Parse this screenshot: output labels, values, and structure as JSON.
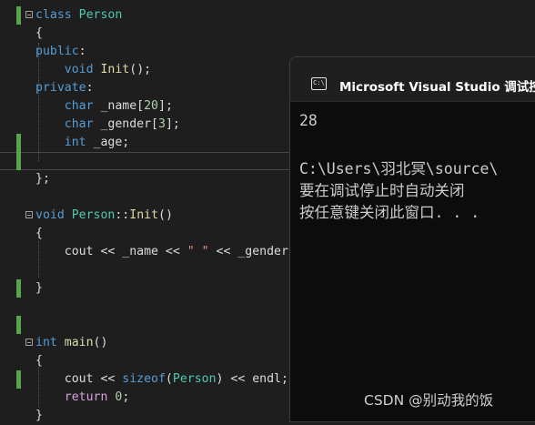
{
  "editor": {
    "lines": [
      {
        "segments": [
          {
            "text": "class",
            "c": "kw"
          },
          {
            "text": " "
          },
          {
            "text": "Person",
            "c": "ty"
          }
        ]
      },
      {
        "segments": [
          {
            "text": "{"
          }
        ]
      },
      {
        "segments": [
          {
            "text": "public",
            "c": "kw"
          },
          {
            "text": ":"
          }
        ]
      },
      {
        "segments": [
          {
            "text": "    "
          },
          {
            "text": "void",
            "c": "kw"
          },
          {
            "text": " "
          },
          {
            "text": "Init",
            "c": "fn"
          },
          {
            "text": "();"
          }
        ]
      },
      {
        "segments": [
          {
            "text": "private",
            "c": "kw"
          },
          {
            "text": ":"
          }
        ]
      },
      {
        "segments": [
          {
            "text": "    "
          },
          {
            "text": "char",
            "c": "kw"
          },
          {
            "text": " _name["
          },
          {
            "text": "20",
            "c": "num"
          },
          {
            "text": "];"
          }
        ]
      },
      {
        "segments": [
          {
            "text": "    "
          },
          {
            "text": "char",
            "c": "kw"
          },
          {
            "text": " _gender["
          },
          {
            "text": "3",
            "c": "num"
          },
          {
            "text": "];"
          }
        ]
      },
      {
        "segments": [
          {
            "text": "    "
          },
          {
            "text": "int",
            "c": "kw"
          },
          {
            "text": " _age;"
          }
        ]
      },
      {
        "segments": [
          {
            "text": ""
          }
        ]
      },
      {
        "segments": [
          {
            "text": "};"
          }
        ]
      },
      {
        "segments": [
          {
            "text": ""
          }
        ]
      },
      {
        "segments": [
          {
            "text": "void",
            "c": "kw"
          },
          {
            "text": " "
          },
          {
            "text": "Person",
            "c": "ty"
          },
          {
            "text": "::"
          },
          {
            "text": "Init",
            "c": "fn"
          },
          {
            "text": "()"
          }
        ]
      },
      {
        "segments": [
          {
            "text": "{"
          }
        ]
      },
      {
        "segments": [
          {
            "text": "    cout << _name << "
          },
          {
            "text": "\" \"",
            "c": "str"
          },
          {
            "text": " << _gender"
          }
        ]
      },
      {
        "segments": [
          {
            "text": ""
          }
        ]
      },
      {
        "segments": [
          {
            "text": "}"
          }
        ]
      },
      {
        "segments": [
          {
            "text": ""
          }
        ]
      },
      {
        "segments": [
          {
            "text": ""
          }
        ]
      },
      {
        "segments": [
          {
            "text": "int",
            "c": "kw"
          },
          {
            "text": " "
          },
          {
            "text": "main",
            "c": "fn"
          },
          {
            "text": "()"
          }
        ]
      },
      {
        "segments": [
          {
            "text": "{"
          }
        ]
      },
      {
        "segments": [
          {
            "text": "    cout << "
          },
          {
            "text": "sizeof",
            "c": "kw"
          },
          {
            "text": "("
          },
          {
            "text": "Person",
            "c": "ty"
          },
          {
            "text": ") << endl;"
          }
        ]
      },
      {
        "segments": [
          {
            "text": "    "
          },
          {
            "text": "return",
            "c": "ret"
          },
          {
            "text": " "
          },
          {
            "text": "0",
            "c": "num"
          },
          {
            "text": ";"
          }
        ]
      },
      {
        "segments": [
          {
            "text": "}"
          }
        ]
      }
    ],
    "fold_markers_on_lines": [
      0,
      11,
      18
    ],
    "changed_lines": [
      0,
      7,
      8,
      15,
      17,
      20
    ],
    "current_line": 8
  },
  "console": {
    "title": "Microsoft Visual Studio 调试控",
    "icon": "console-window-icon",
    "icon_glyph": "C:\\",
    "output": [
      "28",
      "",
      "C:\\Users\\羽北冥\\source\\",
      "要在调试停止时自动关闭",
      "按任意键关闭此窗口. . ."
    ]
  },
  "watermark": "CSDN @别动我的饭",
  "colors": {
    "background": "#1e1e1e",
    "keyword": "#569cd6",
    "type": "#4ec9b0",
    "function": "#dcdcaa",
    "number": "#b5cea8",
    "string": "#d69d85",
    "change_bar": "#57a64a"
  }
}
